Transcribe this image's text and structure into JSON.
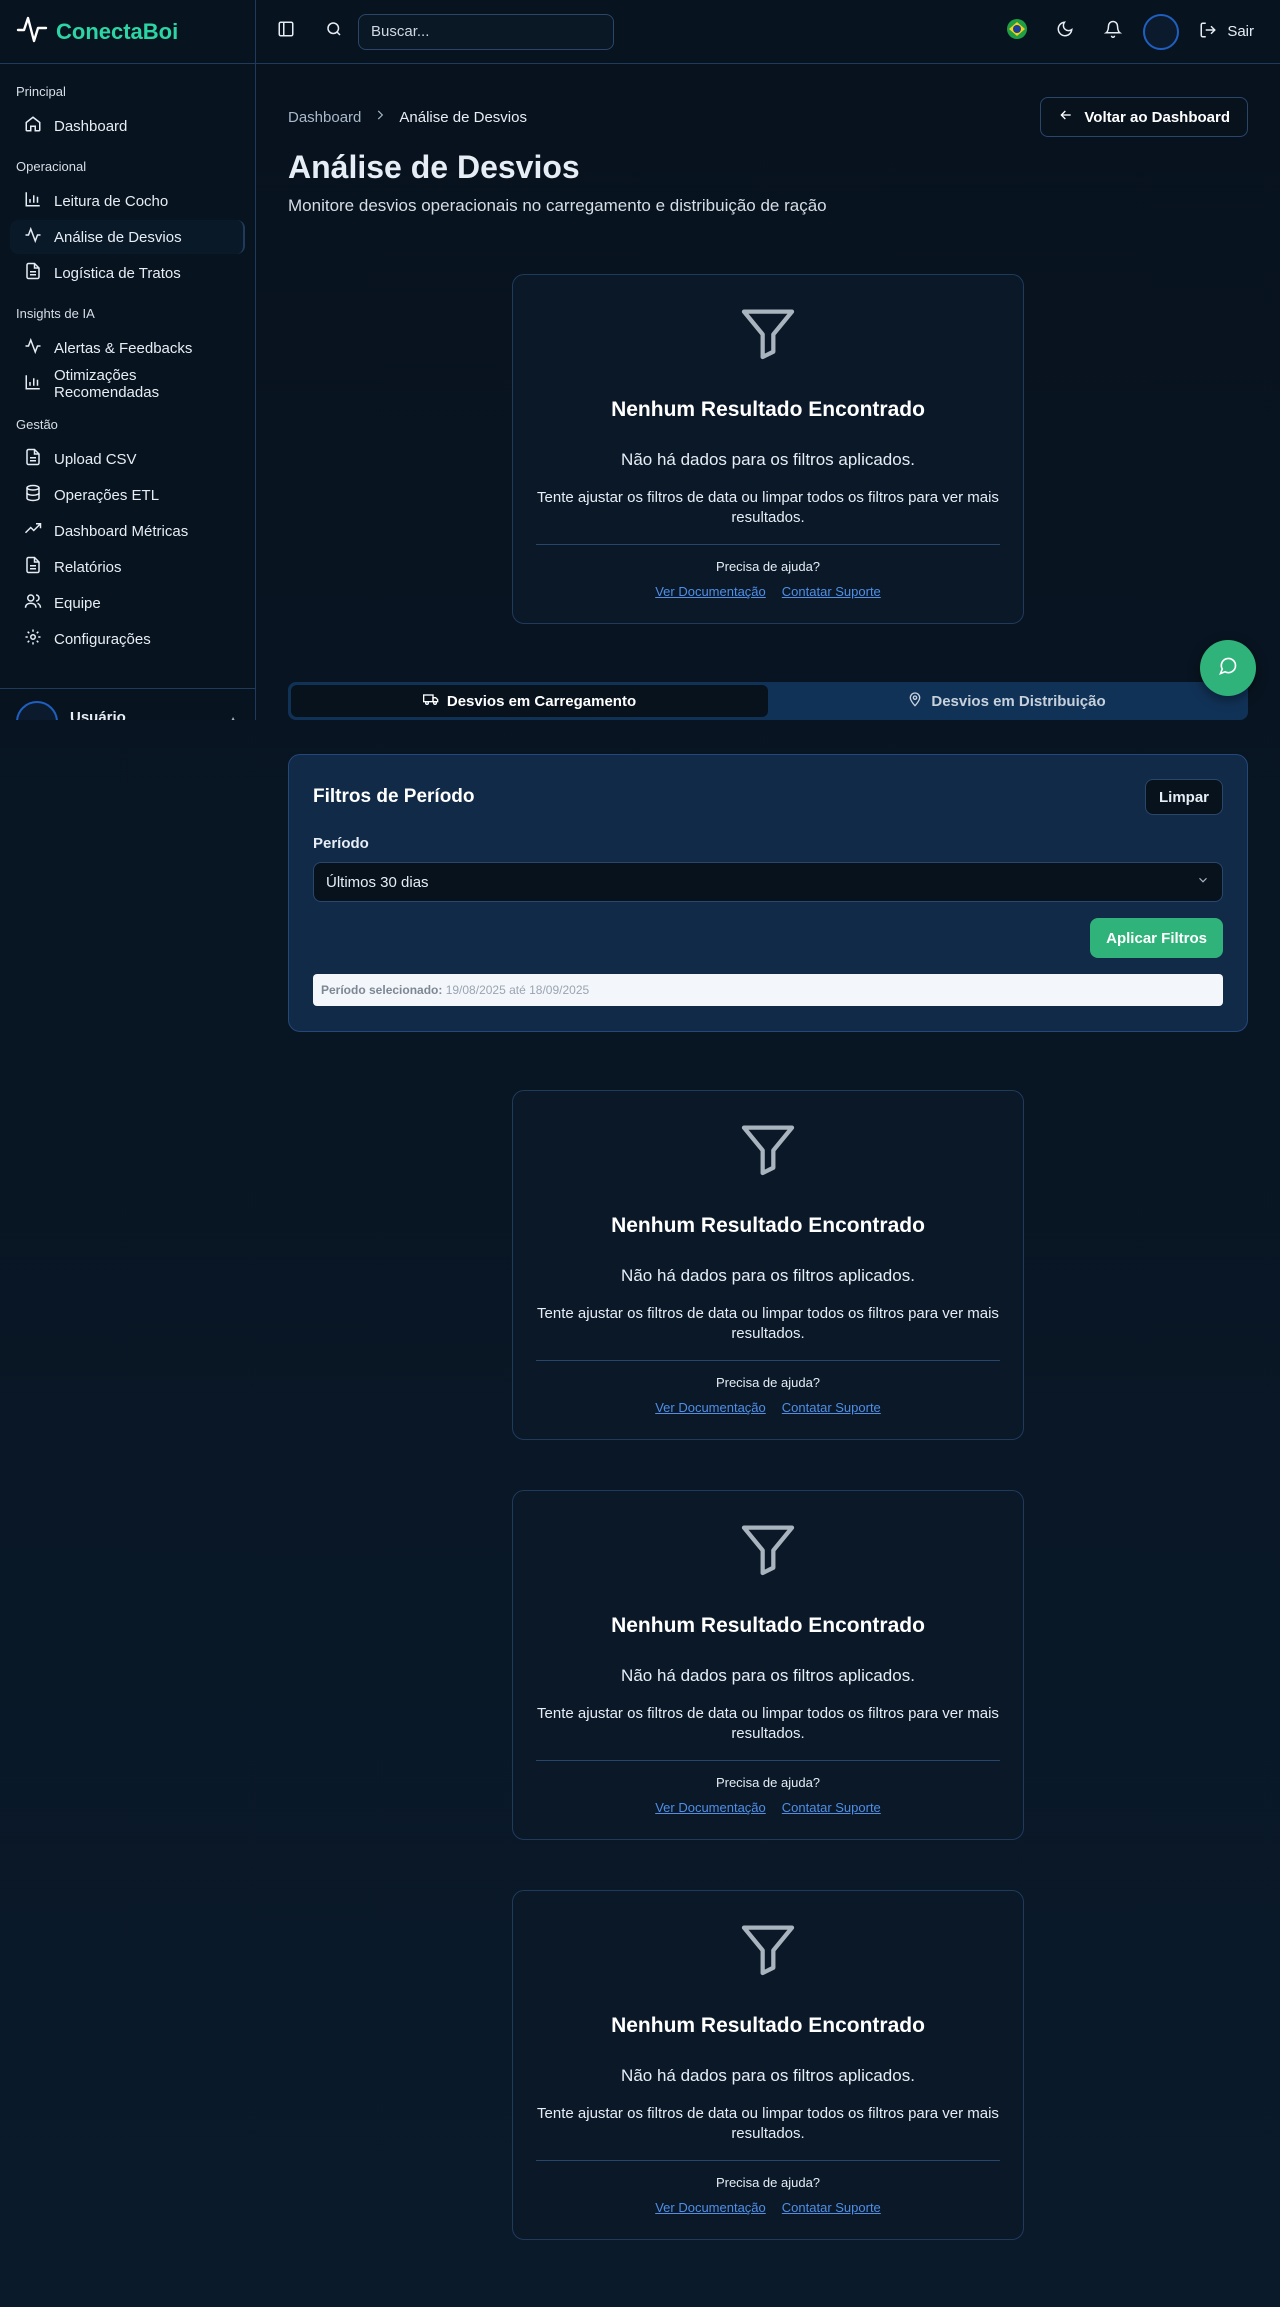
{
  "app": {
    "name": "ConectaBoi"
  },
  "sidebar": {
    "sections": [
      {
        "title": "Principal",
        "items": [
          {
            "label": "Dashboard",
            "icon": "home-icon"
          }
        ]
      },
      {
        "title": "Operacional",
        "items": [
          {
            "label": "Leitura de Cocho",
            "icon": "bar-chart-icon"
          },
          {
            "label": "Análise de Desvios",
            "icon": "activity-icon",
            "active": true
          },
          {
            "label": "Logística de Tratos",
            "icon": "file-text-icon"
          }
        ]
      },
      {
        "title": "Insights de IA",
        "items": [
          {
            "label": "Alertas & Feedbacks",
            "icon": "activity-icon"
          },
          {
            "label": "Otimizações Recomendadas",
            "icon": "bar-chart-icon"
          }
        ]
      },
      {
        "title": "Gestão",
        "items": [
          {
            "label": "Upload CSV",
            "icon": "file-icon"
          },
          {
            "label": "Operações ETL",
            "icon": "database-icon"
          },
          {
            "label": "Dashboard Métricas",
            "icon": "trending-up-icon"
          },
          {
            "label": "Relatórios",
            "icon": "file-text-icon"
          },
          {
            "label": "Equipe",
            "icon": "users-icon"
          },
          {
            "label": "Configurações",
            "icon": "gear-icon"
          }
        ]
      }
    ],
    "user": {
      "name": "Usuário"
    }
  },
  "topbar": {
    "search_placeholder": "Buscar...",
    "logout_label": "Sair"
  },
  "breadcrumb": {
    "root": "Dashboard",
    "current": "Análise de Desvios"
  },
  "back_button": "Voltar ao Dashboard",
  "page": {
    "title": "Análise de Desvios",
    "subtitle": "Monitore desvios operacionais no carregamento e distribuição de ração"
  },
  "empty_state": {
    "title": "Nenhum Resultado Encontrado",
    "message": "Não há dados para os filtros aplicados.",
    "hint": "Tente ajustar os filtros de data ou limpar todos os filtros para ver mais resultados.",
    "help": "Precisa de ajuda?",
    "link_docs": "Ver Documentação",
    "link_support": "Contatar Suporte"
  },
  "tabs": [
    {
      "label": "Desvios em Carregamento",
      "icon": "truck-icon",
      "active": true
    },
    {
      "label": "Desvios em Distribuição",
      "icon": "map-pin-icon",
      "active": false
    }
  ],
  "filters": {
    "title": "Filtros de Período",
    "clear_label": "Limpar",
    "period_label": "Período",
    "period_value": "Últimos 30 dias",
    "apply_label": "Aplicar Filtros",
    "selected_prefix": "Período selecionado:",
    "selected_range": "19/08/2025 até 18/09/2025"
  },
  "colors": {
    "brand": "#2dd4a4",
    "accent_green": "#2fb37a",
    "link": "#4f8fe6"
  }
}
